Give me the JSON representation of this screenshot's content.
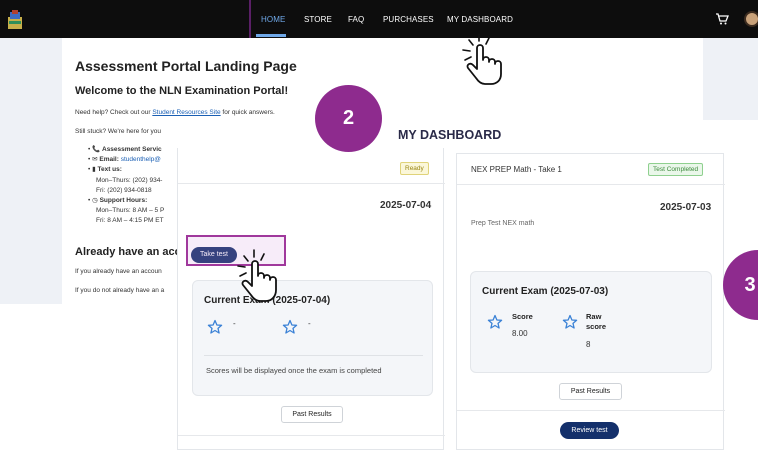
{
  "nav": {
    "items": [
      "HOME",
      "STORE",
      "FAQ",
      "PURCHASES",
      "MY DASHBOARD"
    ],
    "active": "HOME"
  },
  "portal": {
    "title": "Assessment Portal Landing Page",
    "welcome": "Welcome to the NLN Examination Portal!",
    "help_prefix": "Need help? Check out our ",
    "help_link": "Student Resources Site",
    "help_suffix": " for quick answers.",
    "still_stuck": "Still stuck? We're here for you",
    "contact": {
      "assessment_services": "Assessment Servic",
      "email_label": "Email:",
      "email_value": "studenthelp@",
      "text_label": "Text us:",
      "text_line1": "Mon–Thurs: (202) 934-",
      "text_line2": "Fri: (202) 934-0818",
      "support_label": "Support Hours:",
      "support_line1": "Mon–Thurs: 8 AM – 5 P",
      "support_line2": "Fri: 8 AM – 4:15 PM ET"
    },
    "account_heading": "Already have an acco",
    "account_line1": "If you already have an accoun",
    "account_line2": "If you do not already have an a"
  },
  "dashboard": {
    "title": "MY DASHBOARD",
    "left_card": {
      "badge": "Ready",
      "date": "2025-07-04",
      "take_test": "Take test",
      "exam_title": "Current Exam (2025-07-04)",
      "score_placeholder_1": "-",
      "score_placeholder_2": "-",
      "note": "Scores will be displayed once the exam is completed",
      "past_results": "Past Results"
    },
    "right_card": {
      "exam_name": "NEX PREP Math - Take 1",
      "badge": "Test Completed",
      "date": "2025-07-03",
      "description": "Prep Test NEX math",
      "exam_title": "Current Exam (2025-07-03)",
      "score_label": "Score",
      "score_value": "8.00",
      "raw_score_label_1": "Raw",
      "raw_score_label_2": "score",
      "raw_score_value": "8",
      "past_results": "Past Results",
      "review_test": "Review test"
    }
  },
  "steps": {
    "step2": "2",
    "step3": "3"
  },
  "colors": {
    "nav_bg": "#0d0d0d",
    "nav_active": "#6fa8e8",
    "step_circle": "#8e2b8e",
    "primary_button": "#14306b",
    "star_outline": "#3b82d6"
  }
}
